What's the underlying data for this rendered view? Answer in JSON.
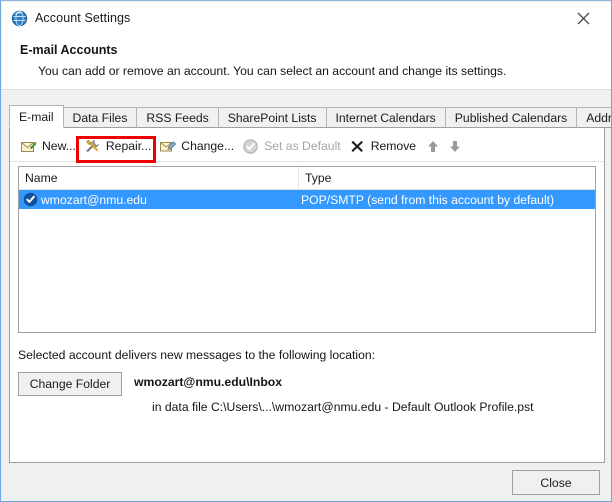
{
  "window": {
    "title": "Account Settings",
    "icon": "outlook-globe-icon",
    "close_label": "✕"
  },
  "header": {
    "title": "E-mail Accounts",
    "subtitle": "You can add or remove an account. You can select an account and change its settings."
  },
  "tabs": [
    {
      "label": "E-mail",
      "active": true
    },
    {
      "label": "Data Files",
      "active": false
    },
    {
      "label": "RSS Feeds",
      "active": false
    },
    {
      "label": "SharePoint Lists",
      "active": false
    },
    {
      "label": "Internet Calendars",
      "active": false
    },
    {
      "label": "Published Calendars",
      "active": false
    },
    {
      "label": "Address Books",
      "active": false
    }
  ],
  "toolbar": {
    "new_label": "New...",
    "repair_label": "Repair...",
    "change_label": "Change...",
    "set_as_default_label": "Set as Default",
    "remove_label": "Remove",
    "move_up_icon": "arrow-up-icon",
    "move_down_icon": "arrow-down-icon",
    "highlight_color": "#ee0000",
    "highlighted_item": "Repair..."
  },
  "accounts_list": {
    "columns": [
      "Name",
      "Type"
    ],
    "rows": [
      {
        "name": "wmozart@nmu.edu",
        "type": "POP/SMTP (send from this account by default)",
        "selected": true,
        "icon": "check-circle-icon"
      }
    ],
    "selection_color": "#3399ff"
  },
  "delivery": {
    "label": "Selected account delivers new messages to the following location:",
    "change_folder_button": "Change Folder",
    "folder_path": "wmozart@nmu.edu\\Inbox",
    "data_file": "in data file C:\\Users\\...\\wmozart@nmu.edu - Default Outlook Profile.pst"
  },
  "footer": {
    "close_label": "Close"
  }
}
